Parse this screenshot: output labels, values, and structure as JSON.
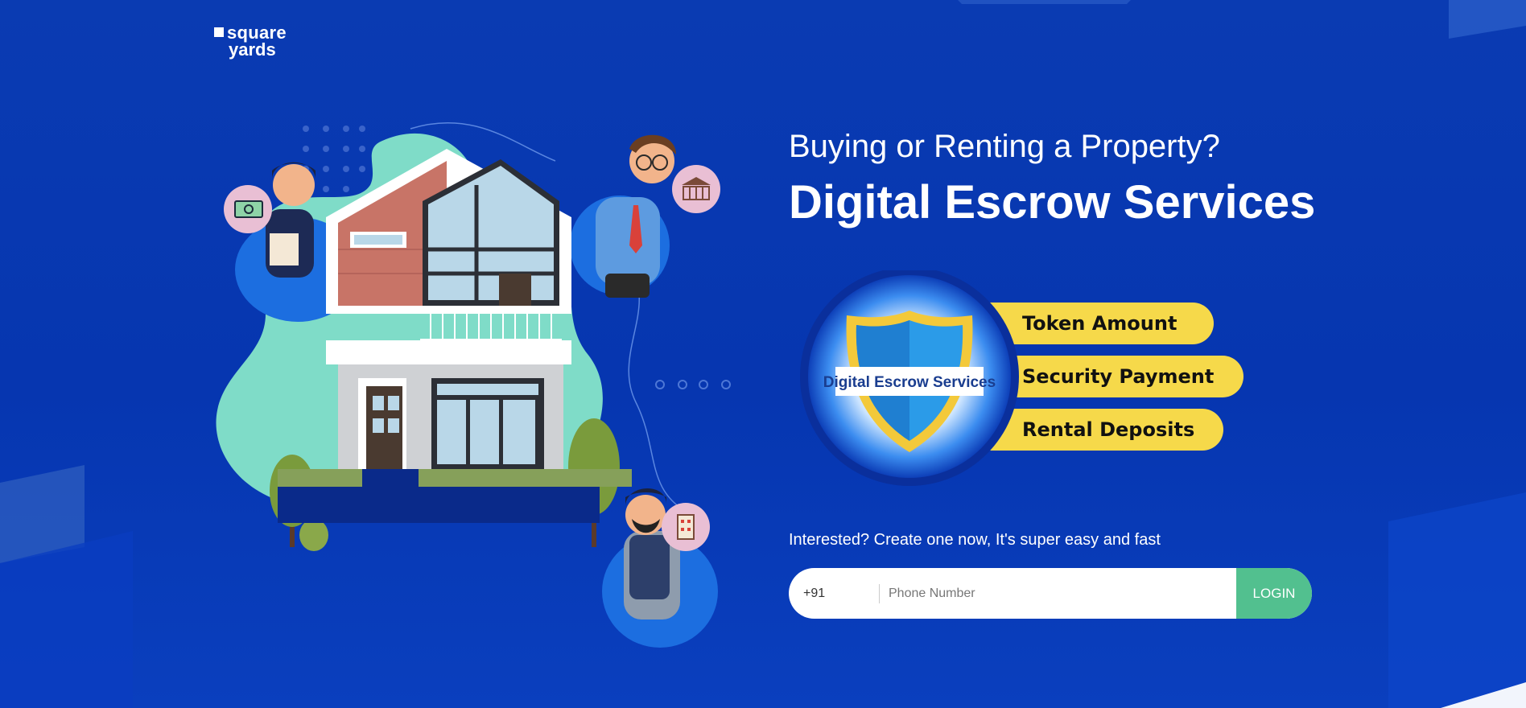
{
  "brand": {
    "line1": "square",
    "line2": "yards"
  },
  "hero": {
    "subtitle": "Buying or Renting a Property?",
    "title": "Digital Escrow Services"
  },
  "badge": {
    "shield_text": "Digital Escrow Services"
  },
  "features": [
    "Token Amount",
    "Security Payment",
    "Rental Deposits"
  ],
  "signup": {
    "prompt": "Interested? Create one now, It's super easy and fast",
    "country_code": "+91",
    "phone_placeholder": "Phone Number",
    "login_label": "LOGIN"
  },
  "colors": {
    "background": "#0738b4",
    "accent_green": "#52c08f",
    "pill_yellow": "#f6d94a",
    "mint_blob": "#7fdcc8"
  },
  "icons": [
    "money-icon",
    "bank-icon",
    "building-icon"
  ]
}
